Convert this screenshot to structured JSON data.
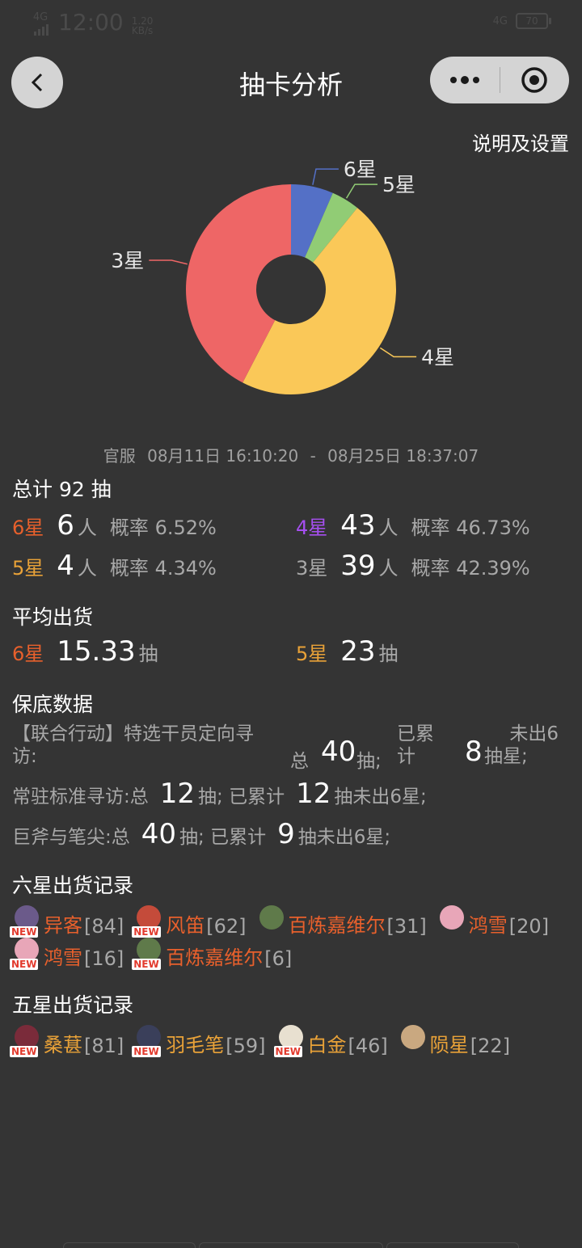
{
  "status_bar": {
    "network": "4G",
    "time": "12:00",
    "speed_value": "1.20",
    "speed_unit": "KB/s",
    "right_network": "4G",
    "battery": "70"
  },
  "nav": {
    "title": "抽卡分析",
    "back_icon": "chevron-left-icon",
    "more_icon": "more-dots-icon",
    "close_icon": "target-circle-icon"
  },
  "settings_link": "说明及设置",
  "chart_data": {
    "type": "pie",
    "donut": true,
    "slices": [
      {
        "label": "6星",
        "value": 6,
        "color": "#5470c6"
      },
      {
        "label": "5星",
        "value": 4,
        "color": "#91cc75"
      },
      {
        "label": "4星",
        "value": 43,
        "color": "#fac858"
      },
      {
        "label": "3星",
        "value": 39,
        "color": "#ee6666"
      }
    ]
  },
  "range": {
    "server": "官服",
    "start": "08月11日 16:10:20",
    "sep": "-",
    "end": "08月25日 18:37:07"
  },
  "total": {
    "title_prefix": "总计",
    "count": "92",
    "unit": "抽"
  },
  "star_stats": [
    {
      "label": "6星",
      "count": "6",
      "unit": "人",
      "rate_label": "概率",
      "rate": "6.52%",
      "color": "#e8602c"
    },
    {
      "label": "4星",
      "count": "43",
      "unit": "人",
      "rate_label": "概率",
      "rate": "46.73%",
      "color": "#a64ff0"
    },
    {
      "label": "5星",
      "count": "4",
      "unit": "人",
      "rate_label": "概率",
      "rate": "4.34%",
      "color": "#e9a238"
    },
    {
      "label": "3星",
      "count": "39",
      "unit": "人",
      "rate_label": "概率",
      "rate": "42.39%",
      "color": "#a8a8a8"
    }
  ],
  "average": {
    "title": "平均出货",
    "items": [
      {
        "label": "6星",
        "value": "15.33",
        "unit": "抽"
      },
      {
        "label": "5星",
        "value": "23",
        "unit": "抽"
      }
    ]
  },
  "pity": {
    "title": "保底数据",
    "first": {
      "name_line1": "【联合行动】特选干员定向寻",
      "name_line2": "访:",
      "total_label": "总",
      "total": "40",
      "total_unit": "抽;",
      "acc_line1": "已累",
      "acc_line2": "计",
      "acc": "8",
      "tail_line1": "未出6",
      "tail_line2_a": "抽",
      "tail_line2_b": "星;"
    },
    "rows": [
      {
        "name": "常驻标准寻访:总",
        "total": "12",
        "mid": "抽; 已累计",
        "acc": "12",
        "tail": "抽未出6星;"
      },
      {
        "name": "巨斧与笔尖:总",
        "total": "40",
        "mid": "抽; 已累计",
        "acc": "9",
        "tail": "抽未出6星;"
      }
    ]
  },
  "six_star_records": {
    "title": "六星出货记录",
    "items": [
      {
        "name": "异客",
        "count": "[84]",
        "new": "NEW",
        "avatar": "#6b5a8a"
      },
      {
        "name": "风笛",
        "count": "[62]",
        "new": "NEW",
        "avatar": "#c44b3a"
      },
      {
        "name": "百炼嘉维尔",
        "count": "[31]",
        "new": "",
        "avatar": "#5f7a4a"
      },
      {
        "name": "鸿雪",
        "count": "[20]",
        "new": "",
        "avatar": "#e8a6b8"
      },
      {
        "name": "鸿雪",
        "count": "[16]",
        "new": "NEW",
        "avatar": "#e8a6b8"
      },
      {
        "name": "百炼嘉维尔",
        "count": "[6]",
        "new": "NEW",
        "avatar": "#5f7a4a"
      }
    ]
  },
  "five_star_records": {
    "title": "五星出货记录",
    "items": [
      {
        "name": "桑葚",
        "count": "[81]",
        "new": "NEW",
        "avatar": "#7a2b3a"
      },
      {
        "name": "羽毛笔",
        "count": "[59]",
        "new": "NEW",
        "avatar": "#3a3f5a"
      },
      {
        "name": "白金",
        "count": "[46]",
        "new": "NEW",
        "avatar": "#e8e0d0"
      },
      {
        "name": "陨星",
        "count": "[22]",
        "new": "",
        "avatar": "#c9a880"
      }
    ]
  }
}
